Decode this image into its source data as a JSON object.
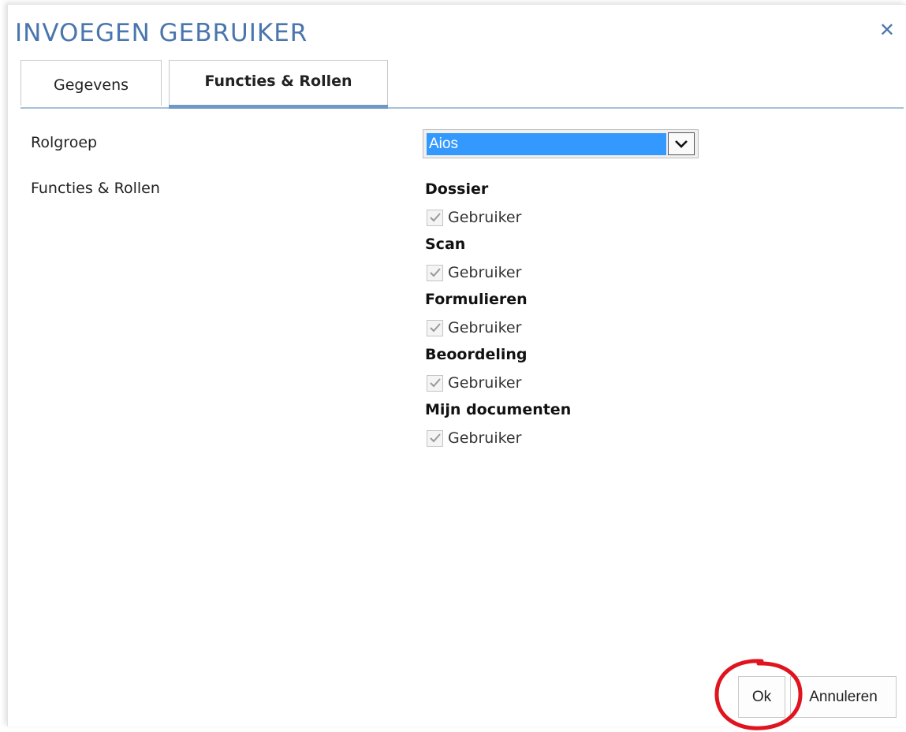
{
  "dialog": {
    "title": "INVOEGEN GEBRUIKER",
    "close_icon": "close-icon"
  },
  "tabs": [
    {
      "label": "Gegevens",
      "active": false
    },
    {
      "label": "Functies & Rollen",
      "active": true
    }
  ],
  "form": {
    "rolgroep_label": "Rolgroep",
    "rolgroep_value": "Aios",
    "functies_label": "Functies & Rollen"
  },
  "groups": [
    {
      "title": "Dossier",
      "role": "Gebruiker",
      "checked": true
    },
    {
      "title": "Scan",
      "role": "Gebruiker",
      "checked": true
    },
    {
      "title": "Formulieren",
      "role": "Gebruiker",
      "checked": true
    },
    {
      "title": "Beoordeling",
      "role": "Gebruiker",
      "checked": true
    },
    {
      "title": "Mijn documenten",
      "role": "Gebruiker",
      "checked": true
    }
  ],
  "buttons": {
    "ok_label": "Ok",
    "cancel_label": "Annuleren"
  },
  "colors": {
    "accent": "#4a76ad",
    "tab_underline": "#6f98c6",
    "select_highlight": "#3399ff",
    "annotation_circle": "#e0141e"
  }
}
